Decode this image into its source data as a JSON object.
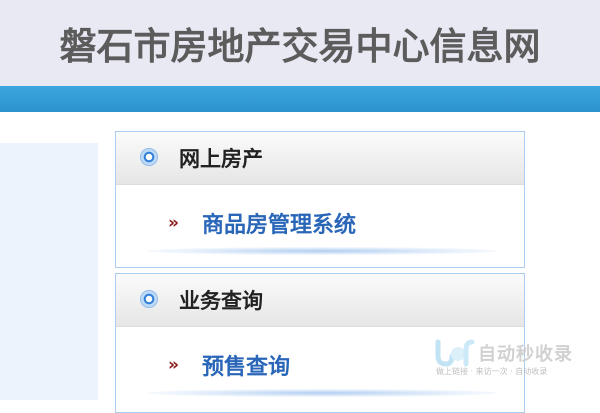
{
  "header": {
    "title": "磐石市房地产交易中心信息网"
  },
  "sections": [
    {
      "title": "网上房产",
      "icon": "bullet-icon",
      "link": {
        "icon": "chevron-icon",
        "text": "商品房管理系统"
      }
    },
    {
      "title": "业务查询",
      "icon": "bullet-icon",
      "link": {
        "icon": "chevron-icon",
        "text": "预售查询"
      }
    }
  ],
  "glyphs": {
    "chevron": "»"
  },
  "watermark": {
    "title": "自动秒收录",
    "subtitle": "做上链接 · 来访一次 · 自动收录",
    "icon": "logo-icon"
  },
  "colors": {
    "banner_bg": "#e9e9f4",
    "banner_text": "#5c5c5c",
    "bar_blue": "#2d92cf",
    "link_blue": "#2a66b8",
    "chevron_red": "#8a1c1c",
    "box_border": "#a9cdf0",
    "left_panel": "#edf3fc"
  }
}
